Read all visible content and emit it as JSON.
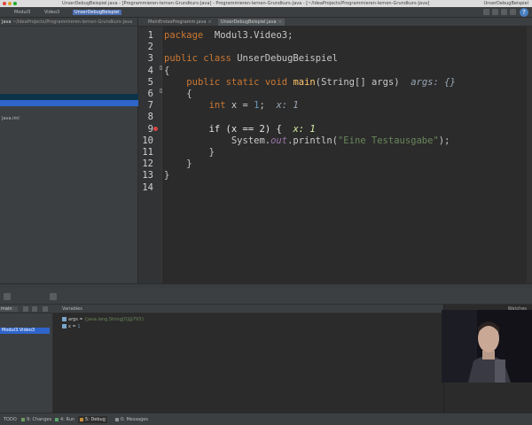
{
  "window": {
    "title": "UnserDebugBeispiel.java - [Programmieren-lernen-Grundkurs-Java] - Programmieren-lernen-Grundkurs-Java - [~/IdeaProjects/Programmieren-lernen-Grundkurs-Java]",
    "right_label": "UnserDebugBeispiel"
  },
  "nav": {
    "crumbs": [
      "Modul3",
      "Video3",
      "UnserDebugBeispiel"
    ],
    "help": "?"
  },
  "project": {
    "header_title": "Java",
    "header_path": "~/IdeaProjects/Programmieren-lernen-Grundkurs-Java",
    "iml_file": "Java.iml"
  },
  "tabs": [
    {
      "label": "MeinErstesProgramm.java",
      "active": false
    },
    {
      "label": "UnserDebugBeispiel.java",
      "active": true
    }
  ],
  "code": {
    "line_numbers": [
      "1",
      "2",
      "3",
      "4",
      "5",
      "6",
      "7",
      "8",
      "9",
      "10",
      "11",
      "12",
      "13",
      "14"
    ],
    "lines": [
      {
        "n": 1,
        "parts": [
          [
            "kw",
            "package"
          ],
          [
            "",
            "  Modul3.Video3;"
          ]
        ]
      },
      {
        "n": 3,
        "parts": [
          [
            "kw",
            "public"
          ],
          [
            "",
            " "
          ],
          [
            "kw",
            "class"
          ],
          [
            "",
            " UnserDebugBeispiel"
          ]
        ]
      },
      {
        "n": 4,
        "parts": [
          [
            "",
            "{"
          ]
        ]
      },
      {
        "n": 5,
        "parts": [
          [
            "",
            "    "
          ],
          [
            "kw",
            "public"
          ],
          [
            "",
            " "
          ],
          [
            "kw",
            "static"
          ],
          [
            "",
            " "
          ],
          [
            "kw",
            "void"
          ],
          [
            "",
            " "
          ],
          [
            "fn",
            "main"
          ],
          [
            "",
            "(String[] args)  "
          ],
          [
            "hint",
            "args: {}"
          ]
        ]
      },
      {
        "n": 6,
        "parts": [
          [
            "",
            "    {"
          ]
        ]
      },
      {
        "n": 7,
        "parts": [
          [
            "",
            "        "
          ],
          [
            "kw",
            "int"
          ],
          [
            "",
            " x = "
          ],
          [
            "num",
            "1"
          ],
          [
            "",
            ";  "
          ],
          [
            "hint",
            "x: 1"
          ]
        ]
      },
      {
        "n": 9,
        "parts": [
          [
            "",
            "        "
          ],
          [
            "kw",
            "if"
          ],
          [
            "",
            " (x == "
          ],
          [
            "num",
            "2"
          ],
          [
            "",
            ") {  "
          ],
          [
            "hint",
            "x: 1"
          ]
        ],
        "highlighted": true
      },
      {
        "n": 10,
        "parts": [
          [
            "",
            "            System."
          ],
          [
            "stat",
            "out"
          ],
          [
            "",
            ".println("
          ],
          [
            "str",
            "\"Eine Testausgabe\""
          ],
          [
            "",
            ");"
          ]
        ]
      },
      {
        "n": 11,
        "parts": [
          [
            "",
            "        }"
          ]
        ]
      },
      {
        "n": 12,
        "parts": [
          [
            "",
            "    }"
          ]
        ]
      },
      {
        "n": 13,
        "parts": [
          [
            "",
            "}"
          ]
        ]
      }
    ]
  },
  "debug": {
    "variables_label": "Variables",
    "watches_label": "Watches",
    "thread": "main",
    "frame": "Modul3.Video3",
    "variables": [
      {
        "name": "args",
        "value": "{java.lang.String[0]@793}"
      },
      {
        "name": "x",
        "value": "1"
      }
    ]
  },
  "bottom_bar": {
    "items": [
      "TODO",
      "9: Changes",
      "4: Run",
      "5: Debug",
      "0: Messages"
    ]
  }
}
